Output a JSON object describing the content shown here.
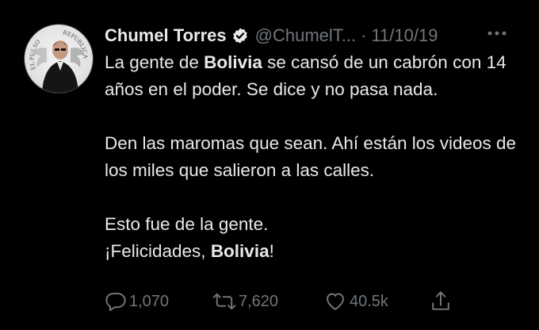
{
  "tweet": {
    "display_name": "Chumel Torres",
    "handle": "@ChumelT...",
    "separator": "·",
    "date": "11/10/19",
    "avatar_text_left": "EL PULSO",
    "avatar_text_right": "REPUBLICA",
    "paragraphs": [
      [
        {
          "text": "La gente de ",
          "bold": false
        },
        {
          "text": "Bolivia",
          "bold": true
        },
        {
          "text": " se cansó de un cabrón con 14 años en el poder. Se dice y no pasa nada.",
          "bold": false
        }
      ],
      [
        {
          "text": "Den las maromas que sean. Ahí están los videos de los miles que salieron a las calles.",
          "bold": false
        }
      ],
      [
        {
          "text": "Esto fue de la gente.",
          "bold": false
        }
      ]
    ],
    "last_line": [
      {
        "text": "¡Felicidades, ",
        "bold": false
      },
      {
        "text": "Bolivia",
        "bold": true
      },
      {
        "text": "!",
        "bold": false
      }
    ],
    "actions": {
      "replies": "1,070",
      "retweets": "7,620",
      "likes": "40.5k"
    },
    "icons": {
      "verified": "verified-badge-icon",
      "more": "more-options-icon",
      "reply": "reply-icon",
      "retweet": "retweet-icon",
      "like": "heart-icon",
      "share": "share-icon"
    }
  }
}
